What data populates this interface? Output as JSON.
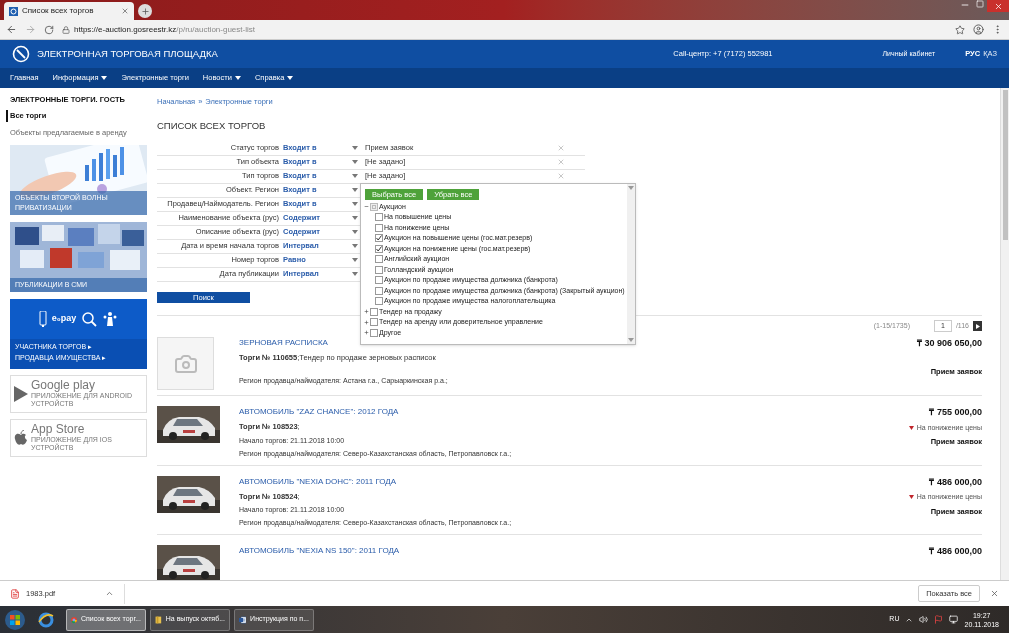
{
  "browser": {
    "tab_title": "Список всех торгов",
    "url_host": "https://e-auction.gosreestr.kz",
    "url_path": "/p/ru/auction-guest-list"
  },
  "header": {
    "site_title": "ЭЛЕКТРОННАЯ ТОРГОВАЯ ПЛОЩАДКА",
    "call_center": "Call-центр: +7 (7172) 552981",
    "cabinet": "Личный кабинет",
    "languages": [
      {
        "label": "РУС",
        "selected": true
      },
      {
        "label": "ҚАЗ",
        "selected": false
      }
    ]
  },
  "nav": [
    {
      "label": "Главная",
      "has_menu": false
    },
    {
      "label": "Информация",
      "has_menu": true
    },
    {
      "label": "Электронные торги",
      "has_menu": false
    },
    {
      "label": "Новости",
      "has_menu": true
    },
    {
      "label": "Справка",
      "has_menu": true
    }
  ],
  "sidebar": {
    "heading": "ЭЛЕКТРОННЫЕ ТОРГИ. ГОСТЬ",
    "items": [
      {
        "label": "Все торги",
        "selected": true
      },
      {
        "label": "Объекты предлагаемые в аренду",
        "selected": false
      }
    ],
    "banners": [
      {
        "kind": "chart",
        "caption": [
          "ОБЪЕКТЫ ВТОРОЙ ВОЛНЫ",
          "ПРИВАТИЗАЦИИ"
        ]
      },
      {
        "kind": "media",
        "caption": [
          "ПУБЛИКАЦИИ В СМИ"
        ]
      }
    ],
    "promo": {
      "logo": "e₀pay",
      "links": [
        "УЧАСТНИКА ТОРГОВ ▸",
        "ПРОДАВЦА ИМУЩЕСТВА ▸"
      ]
    },
    "stores": [
      {
        "kind": "google",
        "title": "Google play",
        "subtitle": "ПРИЛОЖЕНИЕ ДЛЯ ANDROID УСТРОЙСТВ"
      },
      {
        "kind": "apple",
        "title": "App Store",
        "subtitle": "ПРИЛОЖЕНИЕ ДЛЯ IOS УСТРОЙСТВ"
      }
    ]
  },
  "breadcrumb": {
    "items": [
      "Начальная",
      "Электронные торги"
    ],
    "separator": "»"
  },
  "page_title": "СПИСОК ВСЕХ ТОРГОВ",
  "filters": [
    {
      "label": "Статус торгов",
      "operator": "Входит в",
      "value": "Прием заявок"
    },
    {
      "label": "Тип объекта",
      "operator": "Входит в",
      "value": "[Не задано]"
    },
    {
      "label": "Тип торгов",
      "operator": "Входит в",
      "value": "[Не задано]"
    },
    {
      "label": "Объект. Регион",
      "operator": "Входит в"
    },
    {
      "label": "Продавец/Наймодатель. Регион",
      "operator": "Входит в"
    },
    {
      "label": "Наименование объекта (рус)",
      "operator": "Содержит"
    },
    {
      "label": "Описание объекта (рус)",
      "operator": "Содержит"
    },
    {
      "label": "Дата и время начала торгов",
      "operator": "Интервал"
    },
    {
      "label": "Номер торгов",
      "operator": "Равно"
    },
    {
      "label": "Дата публикации",
      "operator": "Интервал"
    }
  ],
  "dropdown": {
    "buttons": [
      "Выбрать все",
      "Убрать все"
    ],
    "tree": [
      {
        "label": "Аукцион",
        "expanded": true,
        "checked": false,
        "partial": true,
        "children": [
          {
            "label": "На повышение цены",
            "checked": false
          },
          {
            "label": "На понижение цены",
            "checked": false
          },
          {
            "label": "Аукцион на повышение цены (гос.мат.резерв)",
            "checked": true
          },
          {
            "label": "Аукцион на понижение цены (гос.мат.резерв)",
            "checked": true
          },
          {
            "label": "Английский аукцион",
            "checked": false
          },
          {
            "label": "Голландский аукцион",
            "checked": false
          },
          {
            "label": "Аукцион по продаже имущества должника (банкрота)",
            "checked": false
          },
          {
            "label": "Аукцион по продаже имущества должника (банкрота) (Закрытый аукцион)",
            "checked": false
          },
          {
            "label": "Аукцион по продаже имущества налогоплательщика",
            "checked": false
          }
        ]
      },
      {
        "label": "Тендер на продажу",
        "expanded": false,
        "checked": false,
        "partial": false
      },
      {
        "label": "Тендер на аренду или доверительное управление",
        "expanded": false,
        "checked": false,
        "partial": false
      },
      {
        "label": "Другое",
        "expanded": false,
        "checked": false,
        "partial": false
      }
    ]
  },
  "search_button": "Поиск",
  "pagination": {
    "range": "(1-15/1735)",
    "page": "1",
    "total": "/116"
  },
  "listings": [
    {
      "kind": "placeholder",
      "title": "ЗЕРНОВАЯ РАСПИСКА",
      "number": "**Торги № 110655**;Тендер по продаже зерновых расписок",
      "region": "Регион продавца/наймодателя:  Астана г.а.,  Сарыаркинская р.а.;",
      "price": "₸ 30 906 050,00",
      "status": "Прием заявок"
    },
    {
      "kind": "picture",
      "title": "АВТОМОБИЛЬ \"ZAZ CHANCE\": 2012 ГОДА",
      "number": "**Торги № 108523**;",
      "start": "Начало торгов:  21.11.2018 10:00",
      "region": "Регион продавца/наймодателя:  Северо-Казахстанская область,  Петропавловск г.а.;",
      "price": "₸ 755 000,00",
      "trend": "На понижение цены",
      "status": "Прием заявок"
    },
    {
      "kind": "picture",
      "title": "АВТОМОБИЛЬ \"NEXIA DOHC\": 2011 ГОДА",
      "number": "**Торги № 108524**;",
      "start": "Начало торгов:  21.11.2018 10:00",
      "region": "Регион продавца/наймодателя:  Северо-Казахстанская область,  Петропавловск г.а.;",
      "price": "₸ 486 000,00",
      "trend": "На понижение цены",
      "status": "Прием заявок"
    },
    {
      "kind": "picture",
      "title": "АВТОМОБИЛЬ \"NEXIA NS 150\": 2011 ГОДА",
      "price": "₸ 486 000,00"
    }
  ],
  "downloads": {
    "file": "1983.pdf",
    "show_all": "Показать все"
  },
  "taskbar": {
    "windows": [
      {
        "kind": "chrome",
        "label": "Список всех торг...",
        "selected": true
      },
      {
        "kind": "folder",
        "label": "На выпуск октяб...",
        "selected": false
      },
      {
        "kind": "word",
        "label": "Инструкция по п...",
        "selected": false
      }
    ],
    "language": "RU",
    "time": "19:27",
    "date": "20.11.2018"
  }
}
